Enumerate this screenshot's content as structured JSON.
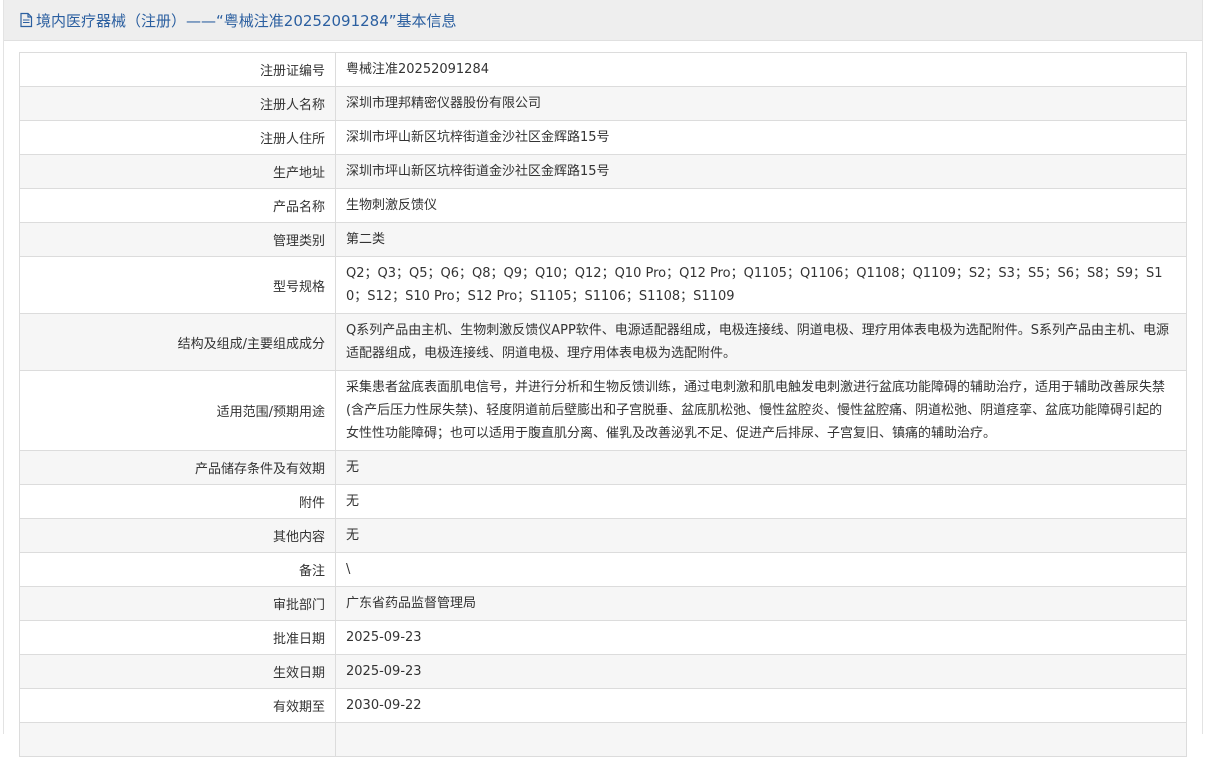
{
  "header": {
    "title": "境内医疗器械（注册）——“粤械注准20252091284”基本信息"
  },
  "rows": [
    {
      "label": "注册证编号",
      "value": "粤械注准20252091284"
    },
    {
      "label": "注册人名称",
      "value": "深圳市理邦精密仪器股份有限公司"
    },
    {
      "label": "注册人住所",
      "value": "深圳市坪山新区坑梓街道金沙社区金辉路15号"
    },
    {
      "label": "生产地址",
      "value": "深圳市坪山新区坑梓街道金沙社区金辉路15号"
    },
    {
      "label": "产品名称",
      "value": "生物刺激反馈仪"
    },
    {
      "label": "管理类别",
      "value": "第二类"
    },
    {
      "label": "型号规格",
      "value": "Q2；Q3；Q5；Q6；Q8；Q9；Q10；Q12；Q10 Pro；Q12 Pro；Q1105；Q1106；Q1108；Q1109；S2；S3；S5；S6；S8；S9；S10；S12；S10 Pro；S12 Pro；S1105；S1106；S1108；S1109"
    },
    {
      "label": "结构及组成/主要组成成分",
      "value": "Q系列产品由主机、生物刺激反馈仪APP软件、电源适配器组成，电极连接线、阴道电极、理疗用体表电极为选配附件。S系列产品由主机、电源适配器组成，电极连接线、阴道电极、理疗用体表电极为选配附件。"
    },
    {
      "label": "适用范围/预期用途",
      "value": "采集患者盆底表面肌电信号，并进行分析和生物反馈训练，通过电刺激和肌电触发电刺激进行盆底功能障碍的辅助治疗，适用于辅助改善尿失禁(含产后压力性尿失禁)、轻度阴道前后壁膨出和子宫脱垂、盆底肌松弛、慢性盆腔炎、慢性盆腔痛、阴道松弛、阴道痉挛、盆底功能障碍引起的女性性功能障碍；也可以适用于腹直肌分离、催乳及改善泌乳不足、促进产后排尿、子宫复旧、镇痛的辅助治疗。"
    },
    {
      "label": "产品储存条件及有效期",
      "value": "无"
    },
    {
      "label": "附件",
      "value": "无"
    },
    {
      "label": "其他内容",
      "value": "无"
    },
    {
      "label": "备注",
      "value": "\\"
    },
    {
      "label": "审批部门",
      "value": "广东省药品监督管理局"
    },
    {
      "label": "批准日期",
      "value": "2025-09-23"
    },
    {
      "label": "生效日期",
      "value": "2025-09-23"
    },
    {
      "label": "有效期至",
      "value": "2030-09-22"
    },
    {
      "label": "",
      "value": ""
    }
  ],
  "colors": {
    "title": "#2b5fa0",
    "header_bg": "#eeeeee",
    "row_alt_bg": "#f6f6f6",
    "border": "#dcdcdc",
    "text": "#333333"
  },
  "icons": {
    "title_icon": "document-icon"
  }
}
